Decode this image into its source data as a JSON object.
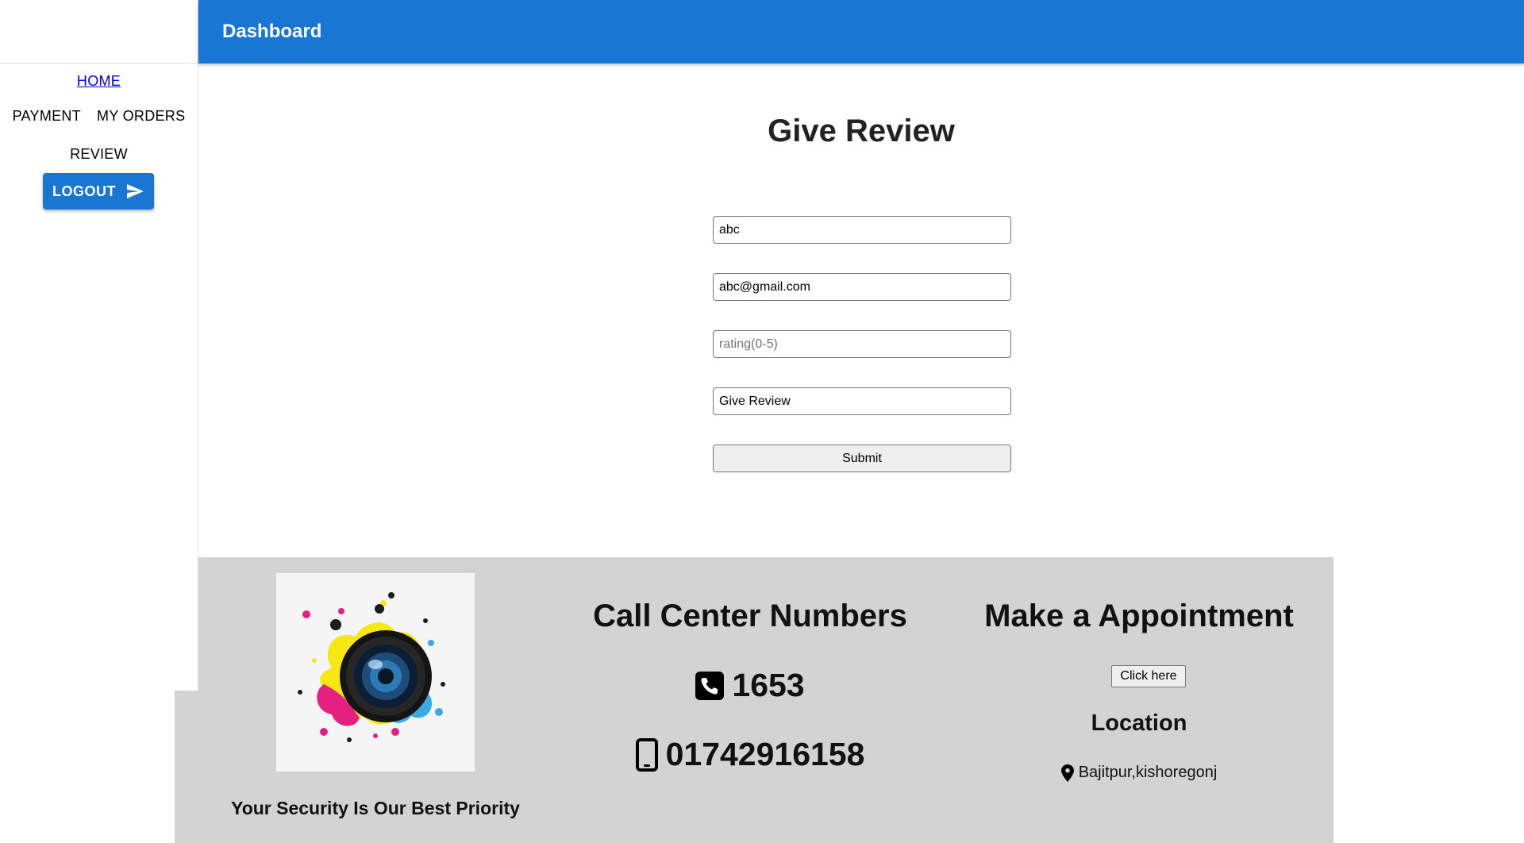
{
  "app": {
    "title": "Dashboard"
  },
  "sidebar": {
    "home": "HOME",
    "payment": "PAYMENT",
    "my_orders": "MY ORDERS",
    "review": "REVIEW",
    "logout": "LOGOUT",
    "logout_icon": "send-icon"
  },
  "main": {
    "title": "Give Review",
    "form": {
      "name_value": "abc",
      "email_value": "abc@gmail.com",
      "rating_value": "",
      "rating_placeholder": "rating(0-5)",
      "comment_value": "Give Review",
      "submit_label": "Submit"
    }
  },
  "footer": {
    "tagline": "Your Security Is Our Best Priority",
    "call_heading": "Call Center Numbers",
    "phone_1": "1653",
    "phone_1_icon": "phone-square-icon",
    "phone_2": "01742916158",
    "phone_2_icon": "mobile-phone-icon",
    "appointment_heading": "Make a Appointment",
    "appointment_button": "Click here",
    "location_heading": "Location",
    "location_text": "Bajitpur,kishoregonj",
    "location_icon": "map-pin-icon"
  },
  "colors": {
    "primary": "#1976d2",
    "footer_bg": "#d3d3d3",
    "link": "#0000ee"
  }
}
